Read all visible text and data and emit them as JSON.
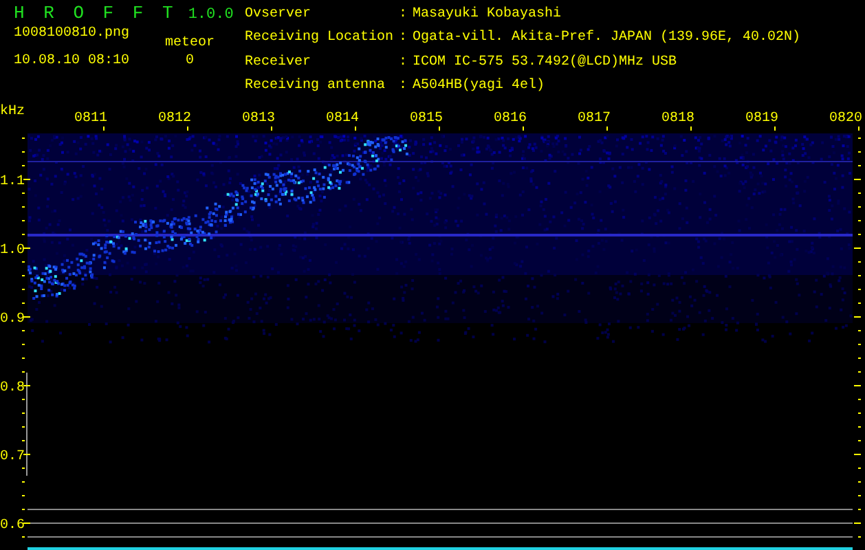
{
  "app": {
    "name": "H R O F F T",
    "version": "1.0.0"
  },
  "file": "1008100810.png",
  "datetime": "10.08.10 08:10",
  "meteor": {
    "label": "meteor",
    "count": "0"
  },
  "info": [
    {
      "label": "Ovserver",
      "separator": ":",
      "value": "Masayuki Kobayashi"
    },
    {
      "label": "Receiving Location",
      "separator": ":",
      "value": "Ogata-vill. Akita-Pref. JAPAN (139.96E, 40.02N)"
    },
    {
      "label": "Receiver",
      "separator": ":",
      "value": "ICOM IC-575 53.7492(@LCD)MHz USB"
    },
    {
      "label": "Receiving antenna",
      "separator": ":",
      "value": "A504HB(yagi 4el)"
    }
  ],
  "spectrogram": {
    "unit": "kHz",
    "time_labels": [
      "0811",
      "0812",
      "0813",
      "0814",
      "0815",
      "0816",
      "0817",
      "0818",
      "0819",
      "0820"
    ],
    "freq_labels": [
      "1.1",
      "1.0",
      "0.9",
      "0.8",
      "0.7",
      "0.6"
    ]
  }
}
